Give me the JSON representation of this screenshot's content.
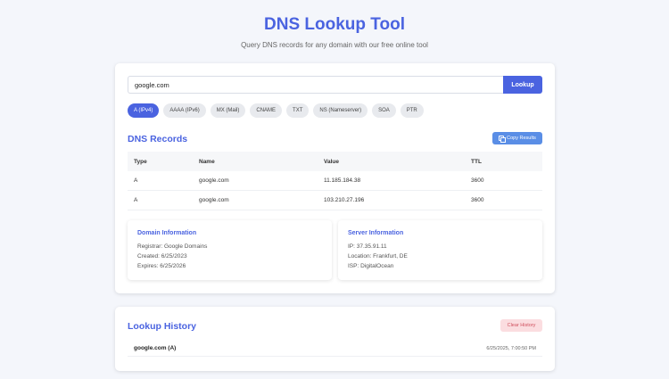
{
  "header": {
    "title": "DNS Lookup Tool",
    "subtitle": "Query DNS records for any domain with our free online tool"
  },
  "search": {
    "value": "google.com",
    "button": "Lookup"
  },
  "record_types": [
    {
      "label": "A (IPv4)",
      "active": true
    },
    {
      "label": "AAAA (IPv6)",
      "active": false
    },
    {
      "label": "MX (Mail)",
      "active": false
    },
    {
      "label": "CNAME",
      "active": false
    },
    {
      "label": "TXT",
      "active": false
    },
    {
      "label": "NS (Nameserver)",
      "active": false
    },
    {
      "label": "SOA",
      "active": false
    },
    {
      "label": "PTR",
      "active": false
    }
  ],
  "records": {
    "title": "DNS Records",
    "copy_button": "Copy Results",
    "columns": [
      "Type",
      "Name",
      "Value",
      "TTL"
    ],
    "rows": [
      [
        "A",
        "google.com",
        "11.185.184.38",
        "3600"
      ],
      [
        "A",
        "google.com",
        "103.210.27.196",
        "3600"
      ]
    ]
  },
  "domain_info": {
    "title": "Domain Information",
    "registrar": "Registrar: Google Domains",
    "created": "Created: 6/25/2023",
    "expires": "Expires: 6/25/2026"
  },
  "server_info": {
    "title": "Server Information",
    "ip": "IP: 37.35.91.11",
    "location": "Location: Frankfurt, DE",
    "isp": "ISP: DigitalOcean"
  },
  "history": {
    "title": "Lookup History",
    "clear_button": "Clear History",
    "items": [
      {
        "query": "google.com (A)",
        "time": "6/25/2025, 7:00:50 PM"
      }
    ]
  },
  "colors": {
    "accent": "#4a63e0",
    "copy_button": "#5a8ee6",
    "clear_button_bg": "#fbdde0",
    "clear_button_text": "#d0505e"
  }
}
